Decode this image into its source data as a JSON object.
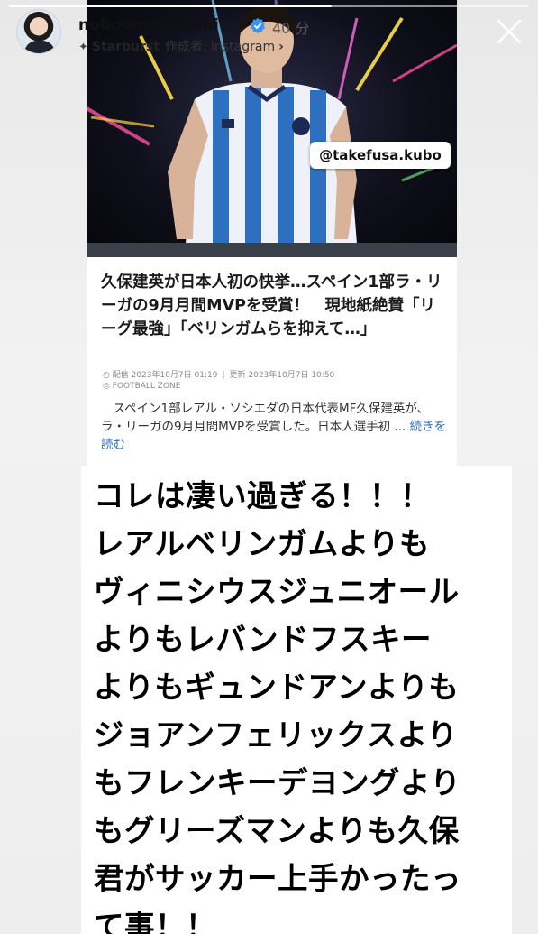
{
  "story": {
    "progress": 0.62
  },
  "header": {
    "username": "noboomanzaishi",
    "time_ago": "40 分",
    "music_title": "Starburst",
    "creator_label": "作成者: instagram",
    "verified_icon": "verified-badge-icon",
    "close_icon": "close-icon"
  },
  "article": {
    "mention": "@takefusa.kubo",
    "headline": "久保建英が日本人初の快挙…スペイン1部ラ・リーガの9月月間MVPを受賞！　現地紙絶賛「リーグ最強」「ベリンガムらを抑えて…」",
    "published": "配信 2023年10月7日 01:19",
    "updated": "更新 2023年10月7日 10:50",
    "source": "FOOTBALL ZONE",
    "summary": "スペイン1部レアル・ソシエダの日本代表MF久保建英が、ラ・リーガの9月月間MVPを受賞した。日本人選手初 ...",
    "read_more": "続きを読む"
  },
  "caption": {
    "lines": [
      "コレは凄い過ぎる！！！",
      "レアルベリンガムよりも",
      "ヴィニシウスジュニオール",
      "よりもレバンドフスキー",
      "よりもギュンドアンよりも",
      "ジョアンフェリックスより",
      "もフレンキーデヨングより",
      "もグリーズマンよりも久保",
      "君がサッカー上手かったっ",
      "て事！！"
    ]
  },
  "colors": {
    "accent_link": "#2a6fb5",
    "verified_blue": "#3897f0"
  }
}
